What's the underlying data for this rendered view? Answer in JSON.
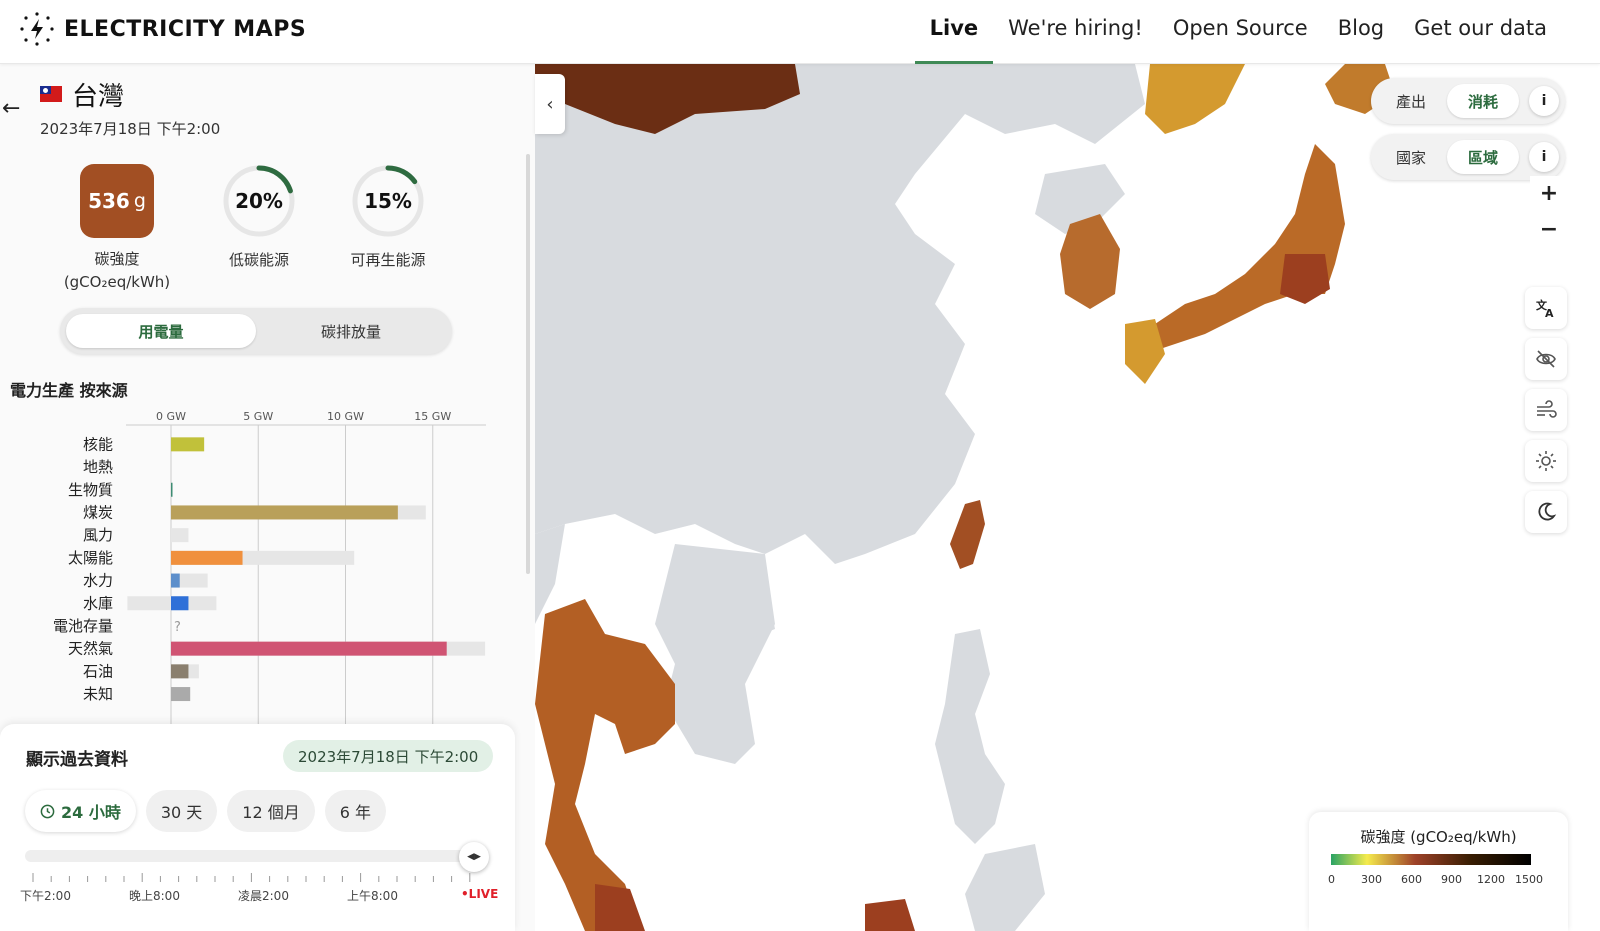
{
  "header": {
    "app_name": "ELECTRICITY MAPS",
    "nav": [
      {
        "label": "Live",
        "active": true
      },
      {
        "label": "We're hiring!"
      },
      {
        "label": "Open Source"
      },
      {
        "label": "Blog"
      },
      {
        "label": "Get our data"
      }
    ]
  },
  "zone": {
    "name": "台灣",
    "datetime": "2023年7月18日 下午2:00",
    "carbon_intensity": {
      "value": "536",
      "unit": "g",
      "label": "碳強度",
      "sublabel": "(gCO₂eq/kWh)"
    },
    "low_carbon": {
      "value": "20%",
      "fraction": 0.2,
      "label": "低碳能源"
    },
    "renewable": {
      "value": "15%",
      "fraction": 0.15,
      "label": "可再生能源"
    },
    "toggle": {
      "selected": "用電量",
      "other": "碳排放量"
    }
  },
  "production_chart_title": "電力生產 按來源",
  "chart_data": {
    "type": "bar",
    "title": "電力生產 按來源",
    "xlabel": "",
    "ylabel": "",
    "x_ticks": [
      "0 GW",
      "5 GW",
      "10 GW",
      "15 GW"
    ],
    "xlim": [
      -2.5,
      18
    ],
    "categories": [
      "核能",
      "地熱",
      "生物質",
      "煤炭",
      "風力",
      "太陽能",
      "水力",
      "水庫",
      "電池存量",
      "天然氣",
      "石油",
      "未知"
    ],
    "values": [
      1.9,
      0,
      0.05,
      13.0,
      0,
      4.1,
      0.5,
      1.0,
      null,
      15.8,
      1.0,
      1.1
    ],
    "capacity": [
      null,
      null,
      null,
      14.6,
      1.0,
      10.5,
      2.1,
      2.6,
      null,
      18.0,
      1.6,
      null
    ],
    "storage_min": [
      null,
      null,
      null,
      null,
      null,
      null,
      null,
      -2.5,
      null,
      null,
      null,
      null
    ],
    "unknown_marker": "?",
    "colors": [
      "#c1c13a",
      "#cc4f3a",
      "#3d8c73",
      "#b9a05a",
      "#74cdb9",
      "#f0903d",
      "#5d8fcb",
      "#2f70d8",
      "#b76ca3",
      "#d05473",
      "#8a7f6e",
      "#aaaaaa"
    ]
  },
  "history": {
    "title": "顯示過去資料",
    "date": "2023年7月18日 下午2:00",
    "ranges": [
      {
        "label": "24 小時",
        "active": true
      },
      {
        "label": "30 天"
      },
      {
        "label": "12 個月"
      },
      {
        "label": "6 年"
      }
    ],
    "time_labels": [
      "下午2:00",
      "晚上8:00",
      "凌晨2:00",
      "上午8:00"
    ],
    "live_label": "•LIVE"
  },
  "map_controls": {
    "production": "產出",
    "consumption": "消耗",
    "selected_mode": "消耗",
    "country": "國家",
    "region": "區域",
    "selected_level": "區域",
    "info": "i",
    "zoom_in": "+",
    "zoom_out": "−"
  },
  "legend": {
    "title": "碳強度 (gCO₂eq/kWh)",
    "ticks": [
      "0",
      "300",
      "600",
      "900",
      "1200",
      "1500"
    ]
  },
  "colors": {
    "accent_green": "#3f8a56",
    "taiwan": "#a24f23",
    "land_no_data": "#d8dbdf"
  }
}
